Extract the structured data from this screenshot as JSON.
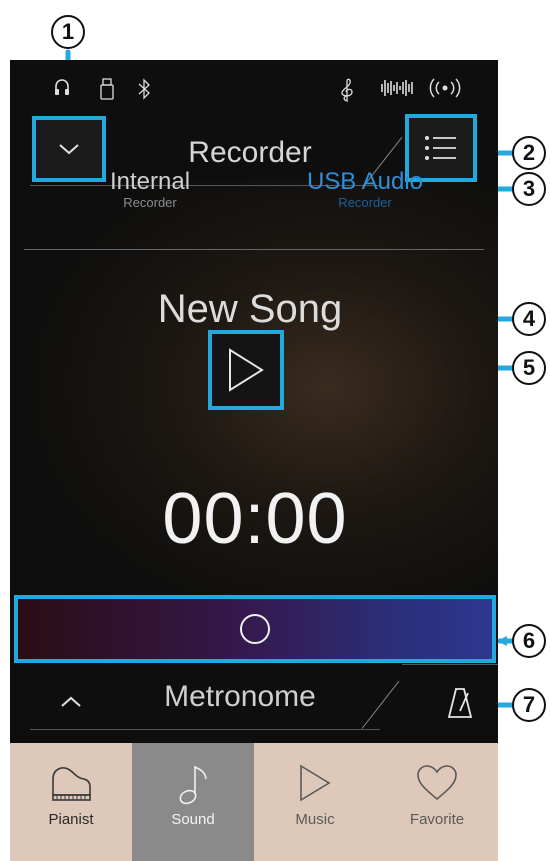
{
  "status_bar": {
    "icons": [
      "headphones-icon",
      "usb-memory-icon",
      "bluetooth-icon",
      "clef-icon",
      "sound-wave-icon",
      "wireless-icon"
    ]
  },
  "header": {
    "title": "Recorder"
  },
  "tabs": [
    {
      "label": "Internal",
      "sublabel": "Recorder",
      "active": false
    },
    {
      "label": "USB Audio",
      "sublabel": "Recorder",
      "active": true
    }
  ],
  "player": {
    "song_name": "New Song",
    "time": "00:00"
  },
  "metronome": {
    "label": "Metronome"
  },
  "bottom_nav": [
    {
      "label": "Pianist",
      "icon": "grand-piano-icon"
    },
    {
      "label": "Sound",
      "icon": "music-note-icon"
    },
    {
      "label": "Music",
      "icon": "play-icon"
    },
    {
      "label": "Favorite",
      "icon": "heart-icon"
    }
  ],
  "callouts": [
    "1",
    "2",
    "3",
    "4",
    "5",
    "6",
    "7"
  ],
  "colors": {
    "highlight": "#24a9df",
    "active_tab": "#2d8fd8",
    "nav_background": "#ddc8b9",
    "nav_active": "#8a8a8a",
    "screen_background": "#0e0e0e"
  }
}
